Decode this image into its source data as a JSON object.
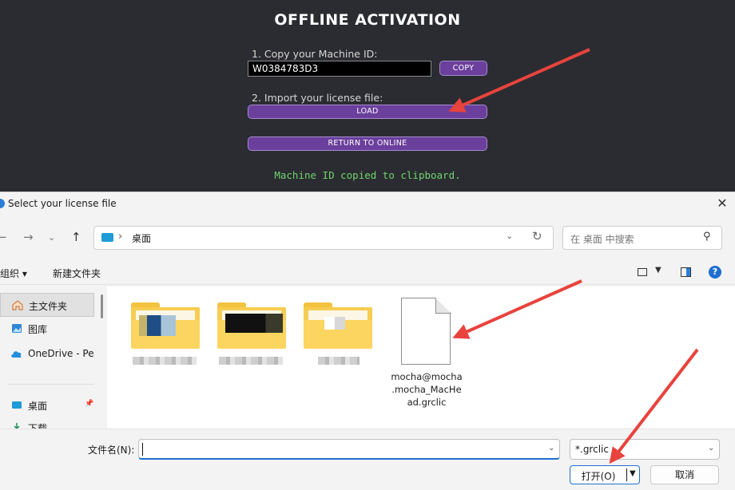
{
  "activation": {
    "title": "OFFLINE ACTIVATION",
    "step1_label": "1. Copy your Machine ID:",
    "machine_id": "W0384783D3",
    "copy_label": "COPY",
    "step2_label": "2. Import your license file:",
    "load_label": "LOAD",
    "return_label": "RETURN TO ONLINE",
    "status_message": "Machine ID copied to clipboard."
  },
  "dialog": {
    "title": "Select your license file",
    "address": {
      "location": "桌面"
    },
    "search_placeholder": "在 桌面 中搜索",
    "toolbar": {
      "organize_label": "组织 ▾",
      "new_folder_label": "新建文件夹"
    },
    "sidebar": [
      {
        "label": "主文件夹",
        "icon": "home-icon",
        "selected": true
      },
      {
        "label": "图库",
        "icon": "gallery-icon",
        "selected": false
      },
      {
        "label": "OneDrive - Per",
        "icon": "cloud-icon",
        "selected": false
      },
      {
        "label": "桌面",
        "icon": "desktop-icon",
        "selected": false
      },
      {
        "label": "下载",
        "icon": "download-icon",
        "selected": false
      }
    ],
    "files": [
      {
        "name": "mocha@mocha.mocha_MacHead.grclic",
        "name_lines": [
          "mocha@mocha",
          ".mocha_MacHe",
          "ad.grclic"
        ]
      }
    ],
    "filename_label": "文件名(N):",
    "filename_value": "",
    "filetype_value": "*.grclic",
    "open_label": "打开(O)",
    "cancel_label": "取消"
  },
  "colors": {
    "background": "#2b2c31",
    "button_purple": "#6b3f9c",
    "status_green": "#6fd46f",
    "arrow_red": "#e8433d",
    "dialog_bg": "#f3f3f3",
    "accent_blue": "#1e6fcf",
    "folder_yellow": "#f6cd52"
  }
}
